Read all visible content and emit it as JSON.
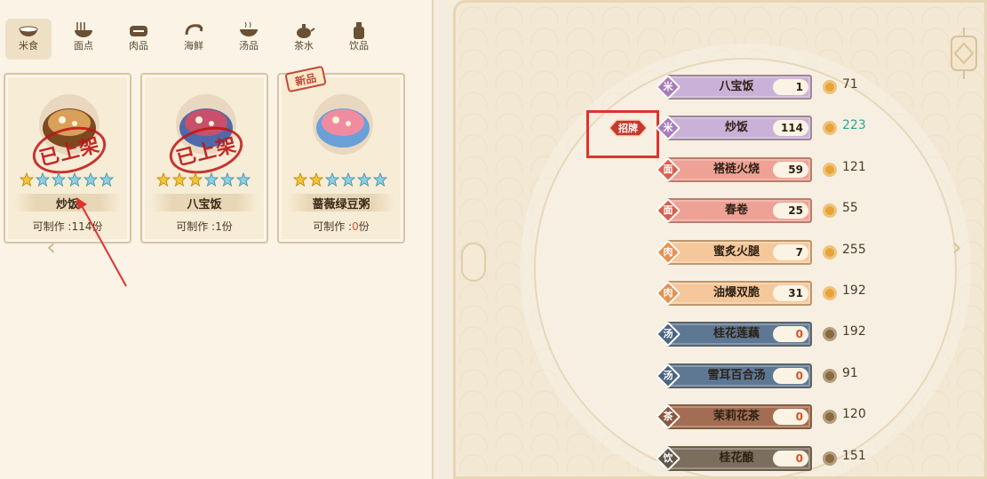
{
  "categories": [
    {
      "label": "米食",
      "icon": "rice-bowl-icon",
      "active": true
    },
    {
      "label": "面点",
      "icon": "noodle-bowl-icon",
      "active": false
    },
    {
      "label": "肉品",
      "icon": "meat-icon",
      "active": false
    },
    {
      "label": "海鲜",
      "icon": "shrimp-icon",
      "active": false
    },
    {
      "label": "汤品",
      "icon": "soup-icon",
      "active": false
    },
    {
      "label": "茶水",
      "icon": "teapot-icon",
      "active": false
    },
    {
      "label": "饮品",
      "icon": "drink-bottle-icon",
      "active": false
    }
  ],
  "recipes": [
    {
      "name": "炒饭",
      "stars_filled": 1,
      "stars_total": 6,
      "makeable_prefix": "可制作 :",
      "makeable_count": "114",
      "makeable_suffix": "份",
      "stamp": "已上架",
      "new": false
    },
    {
      "name": "八宝饭",
      "stars_filled": 3,
      "stars_total": 6,
      "makeable_prefix": "可制作 :",
      "makeable_count": "1",
      "makeable_suffix": "份",
      "stamp": "已上架",
      "new": false
    },
    {
      "name": "蔷薇绿豆粥",
      "stars_filled": 2,
      "stars_total": 6,
      "makeable_prefix": "可制作 :",
      "makeable_count": "0",
      "makeable_suffix": "份",
      "stamp": "",
      "new": true,
      "new_label": "新品"
    }
  ],
  "signature": {
    "label": "招牌"
  },
  "dishes": [
    {
      "type": "米",
      "name": "八宝饭",
      "count": "1",
      "price": "71",
      "color": "#c9b1d7",
      "diamond": "#a87bbb",
      "coin": "#e8a43a"
    },
    {
      "type": "米",
      "name": "炒饭",
      "count": "114",
      "price": "223",
      "color": "#c9b1d7",
      "diamond": "#a87bbb",
      "coin": "#e8a43a",
      "highlight": true
    },
    {
      "type": "面",
      "name": "褡裢火烧",
      "count": "59",
      "price": "121",
      "color": "#eea195",
      "diamond": "#d8604e",
      "coin": "#e8a43a"
    },
    {
      "type": "面",
      "name": "春卷",
      "count": "25",
      "price": "55",
      "color": "#eea195",
      "diamond": "#d8604e",
      "coin": "#e8a43a"
    },
    {
      "type": "肉",
      "name": "蜜炙火腿",
      "count": "7",
      "price": "255",
      "color": "#f4c89a",
      "diamond": "#e59150",
      "coin": "#e8a43a"
    },
    {
      "type": "肉",
      "name": "油爆双脆",
      "count": "31",
      "price": "192",
      "color": "#f4c89a",
      "diamond": "#e59150",
      "coin": "#e8a43a"
    },
    {
      "type": "汤",
      "name": "桂花莲藕",
      "count": "0",
      "price": "192",
      "color": "#5e7894",
      "diamond": "#4a6482",
      "coin": "#8b6a40"
    },
    {
      "type": "汤",
      "name": "雪耳百合汤",
      "count": "0",
      "price": "91",
      "color": "#5e7894",
      "diamond": "#4a6482",
      "coin": "#8b6a40"
    },
    {
      "type": "茶",
      "name": "茉莉花茶",
      "count": "0",
      "price": "120",
      "color": "#a26d52",
      "diamond": "#8a5640",
      "coin": "#8b6a40"
    },
    {
      "type": "饮",
      "name": "桂花酿",
      "count": "0",
      "price": "151",
      "color": "#7b6e5c",
      "diamond": "#62574a",
      "coin": "#8b6a40"
    }
  ]
}
